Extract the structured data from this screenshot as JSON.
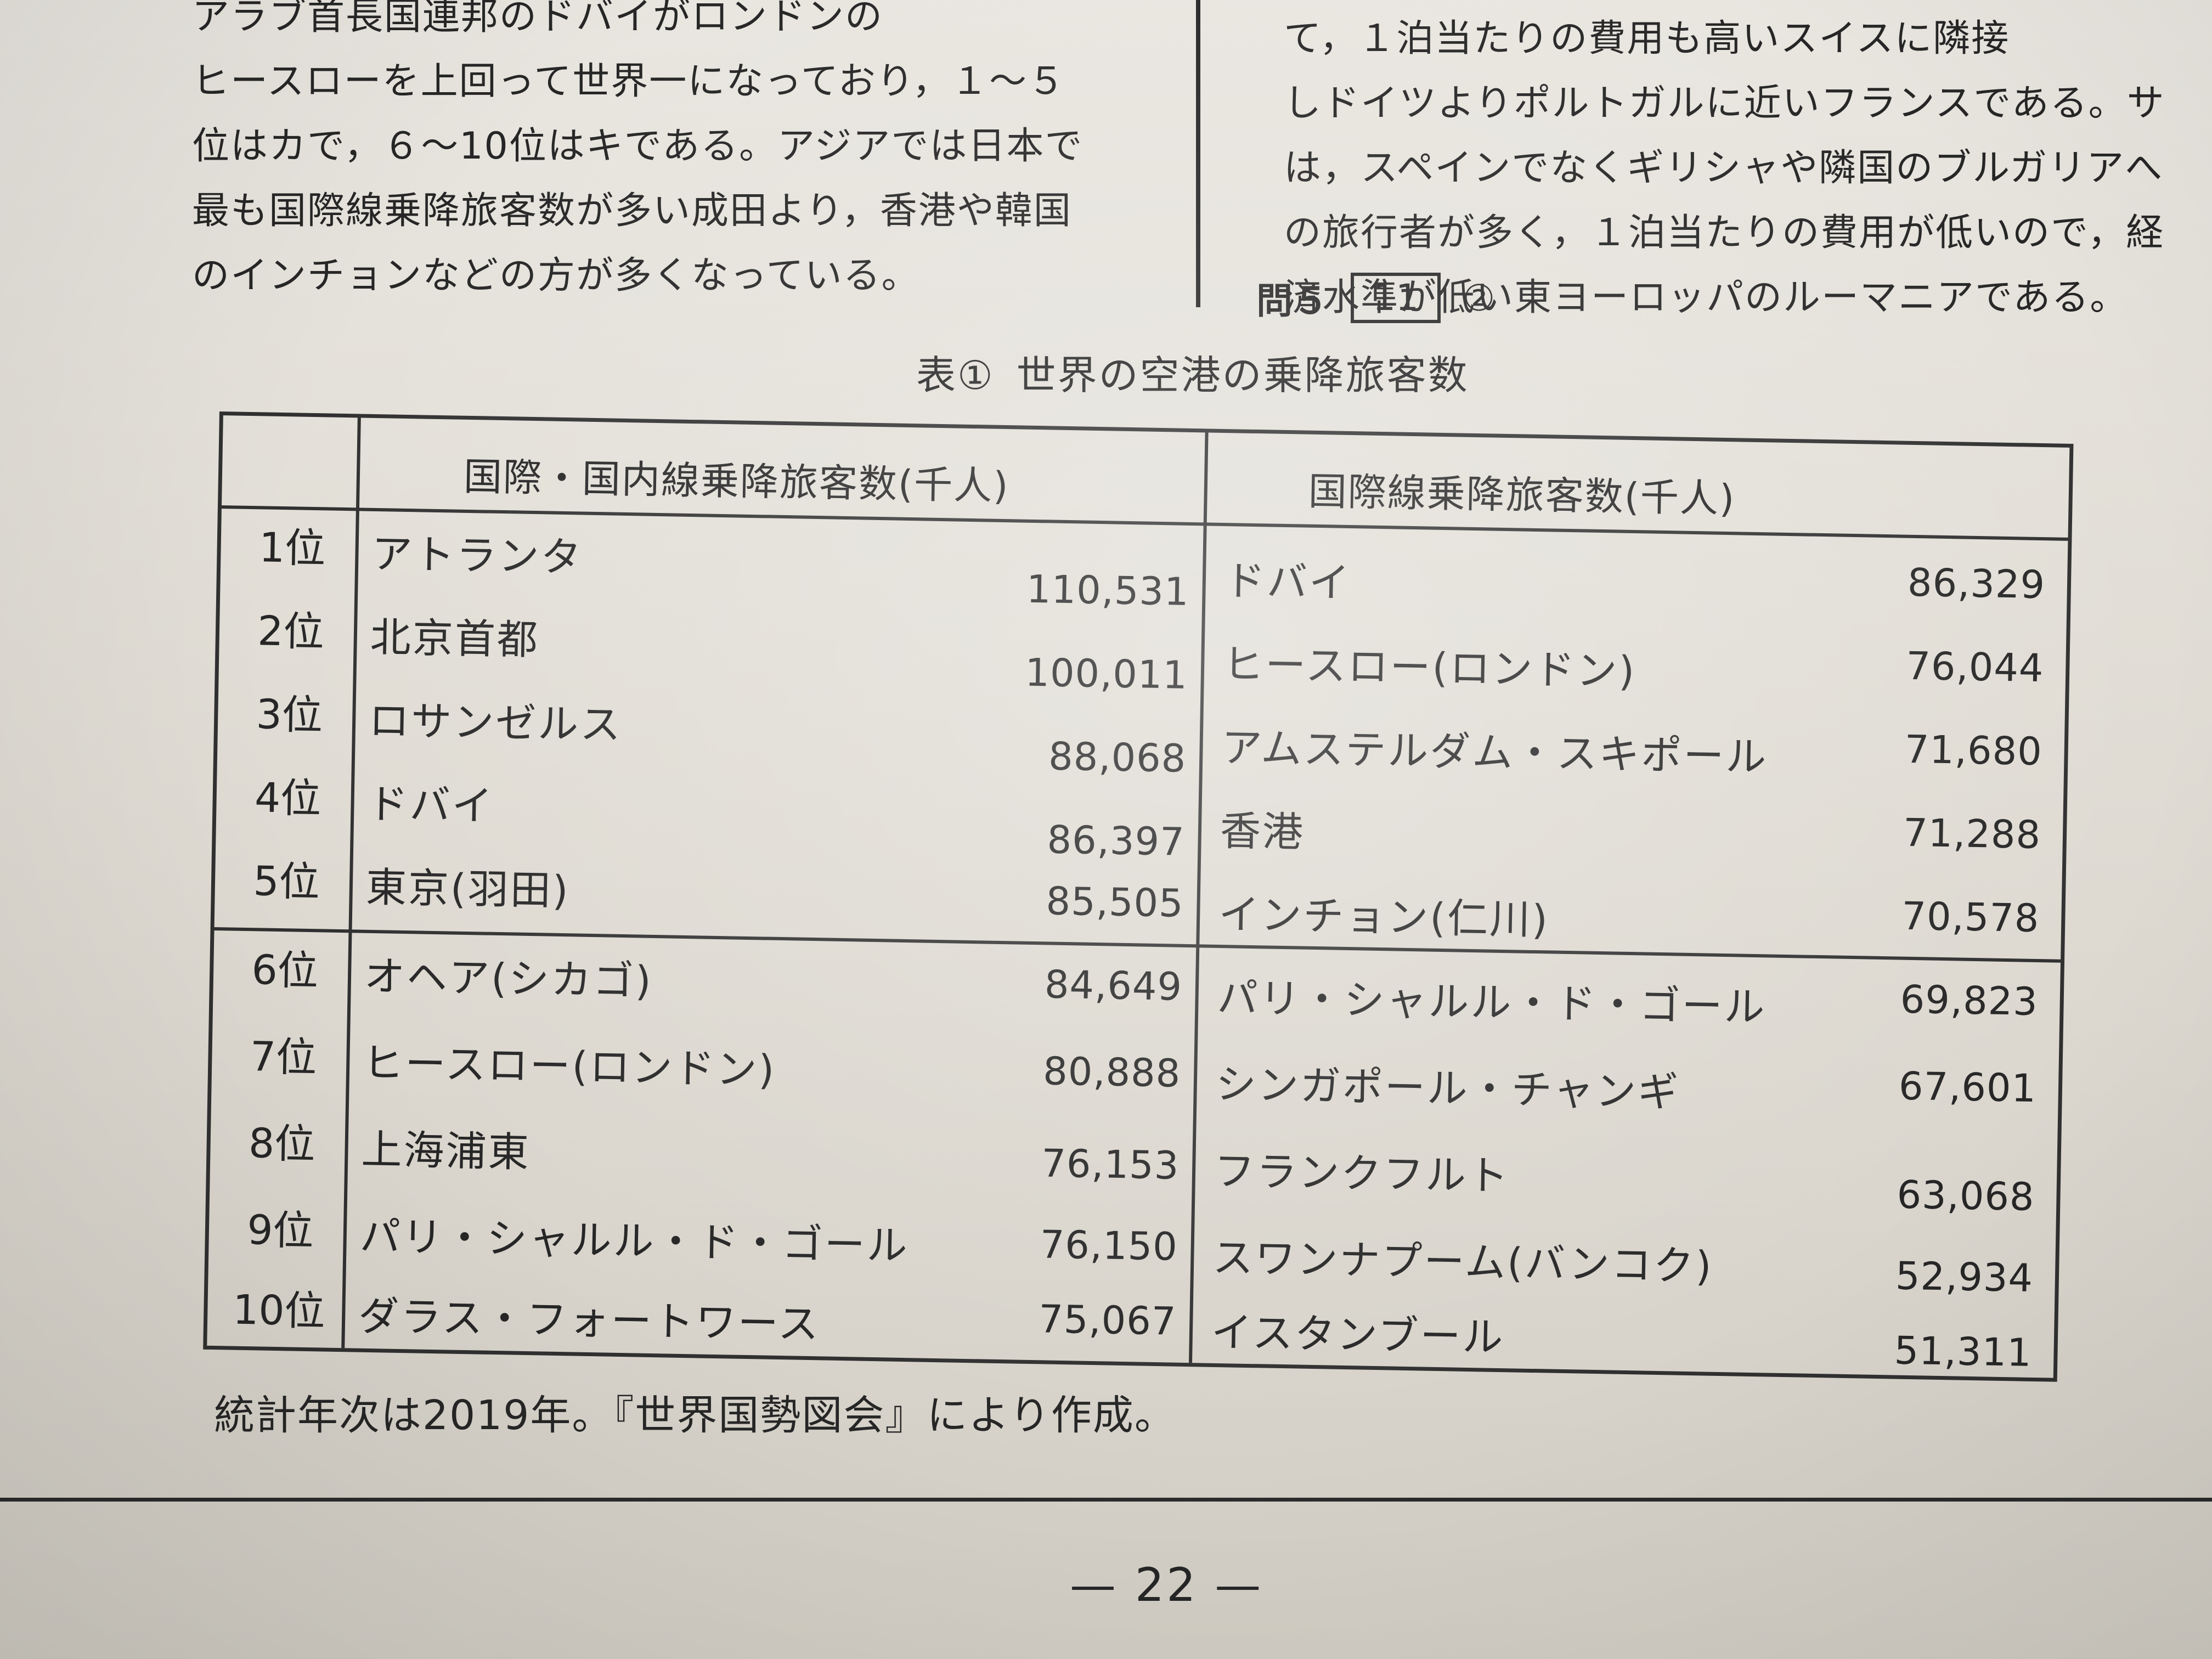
{
  "left_column": {
    "lines": [
      "アラブ首長国連邦のドバイがロンドンの",
      "ヒースローを上回って世界一になっており，１～５",
      "位はカで，６～10位はキである。アジアでは日本で",
      "最も国際線乗降旅客数が多い成田より，香港や韓国",
      "のインチョンなどの方が多くなっている。"
    ]
  },
  "right_column": {
    "lines": [
      "て，１泊当たりの費用も高いスイスに隣接",
      "しドイツよりポルトガルに近いフランスである。サ",
      "は，スペインでなくギリシャや隣国のブルガリアへ",
      "の旅行者が多く，１泊当たりの費用が低いので，経",
      "済水準が低い東ヨーロッパのルーマニアである。"
    ]
  },
  "question": {
    "label": "問５",
    "answer_box": "11",
    "answer": "②"
  },
  "table": {
    "number": "表①",
    "title": "世界の空港の乗降旅客数",
    "headers": {
      "col1": "国際・国内線乗降旅客数(千人)",
      "col2": "国際線乗降旅客数(千人)"
    },
    "rows": [
      {
        "rank": "1位",
        "name1": "アトランタ",
        "val1": "110,531",
        "name2": "ドバイ",
        "val2": "86,329"
      },
      {
        "rank": "2位",
        "name1": "北京首都",
        "val1": "100,011",
        "name2": "ヒースロー(ロンドン)",
        "val2": "76,044"
      },
      {
        "rank": "3位",
        "name1": "ロサンゼルス",
        "val1": "88,068",
        "name2": "アムステルダム・スキポール",
        "val2": "71,680"
      },
      {
        "rank": "4位",
        "name1": "ドバイ",
        "val1": "86,397",
        "name2": "香港",
        "val2": "71,288"
      },
      {
        "rank": "5位",
        "name1": "東京(羽田)",
        "val1": "85,505",
        "name2": "インチョン(仁川)",
        "val2": "70,578"
      },
      {
        "rank": "6位",
        "name1": "オヘア(シカゴ)",
        "val1": "84,649",
        "name2": "パリ・シャルル・ド・ゴール",
        "val2": "69,823"
      },
      {
        "rank": "7位",
        "name1": "ヒースロー(ロンドン)",
        "val1": "80,888",
        "name2": "シンガポール・チャンギ",
        "val2": "67,601"
      },
      {
        "rank": "8位",
        "name1": "上海浦東",
        "val1": "76,153",
        "name2": "フランクフルト",
        "val2": "63,068"
      },
      {
        "rank": "9位",
        "name1": "パリ・シャルル・ド・ゴール",
        "val1": "76,150",
        "name2": "スワンナプーム(バンコク)",
        "val2": "52,934"
      },
      {
        "rank": "10位",
        "name1": "ダラス・フォートワース",
        "val1": "75,067",
        "name2": "イスタンブール",
        "val2": "51,311"
      }
    ]
  },
  "source_note": "統計年次は2019年。『世界国勢図会』により作成。",
  "page_number": "— 22 —"
}
